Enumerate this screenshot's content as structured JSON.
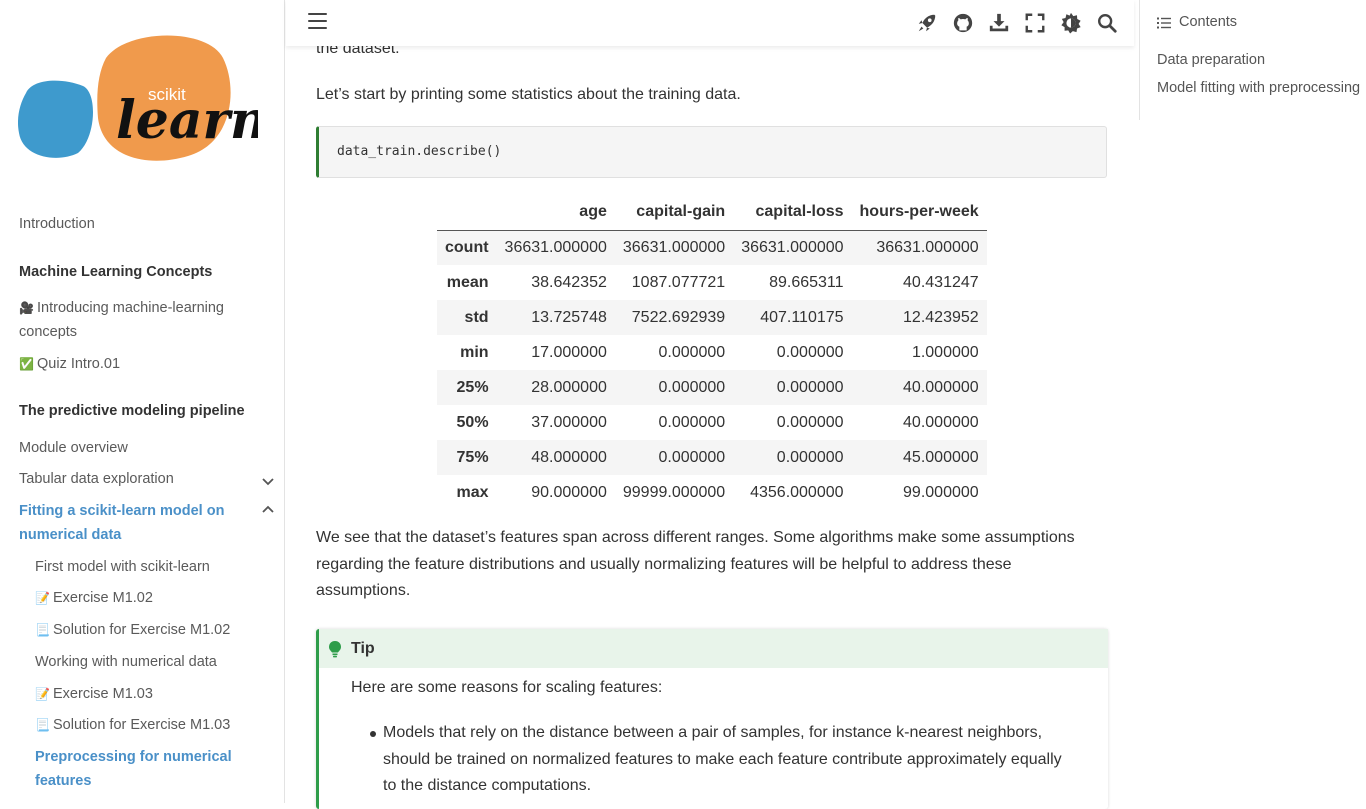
{
  "logo": {
    "text_small": "scikit",
    "text_large": "learn",
    "colors": {
      "orange": "#F09A4C",
      "blue": "#3E9ACD"
    }
  },
  "sidebar": {
    "items": [
      {
        "label": "Introduction",
        "style": "normal"
      },
      {
        "label": "Machine Learning Concepts",
        "style": "bold"
      },
      {
        "label": "Introducing machine-learning",
        "label2": "concepts",
        "icon": "🎥"
      },
      {
        "label": "Quiz Intro.01",
        "icon": "✅"
      },
      {
        "label": "The predictive modeling pipeline",
        "style": "bold"
      },
      {
        "label": "Module overview"
      },
      {
        "label": "Tabular data exploration",
        "chevron": "down"
      },
      {
        "label": "Fitting a scikit-learn model on",
        "label2": "numerical data",
        "style": "active",
        "chevron": "up"
      },
      {
        "label": "First model with scikit-learn"
      },
      {
        "label": "Exercise M1.02",
        "icon": "📝"
      },
      {
        "label": "Solution for Exercise M1.02",
        "icon": "📃"
      },
      {
        "label": "Working with numerical data"
      },
      {
        "label": "Exercise M1.03",
        "icon": "📝"
      },
      {
        "label": "Solution for Exercise M1.03",
        "icon": "📃"
      },
      {
        "label": "Preprocessing for numerical",
        "label2": "features",
        "style": "active"
      }
    ]
  },
  "toolbar": {
    "icons": [
      "menu-icon",
      "rocket-icon",
      "github-icon",
      "download-icon",
      "fullscreen-icon",
      "theme-icon",
      "search-icon"
    ]
  },
  "content": {
    "fragment": "the dataset.",
    "intro": "Let’s start by printing some statistics about the training data.",
    "code": "data_train.describe()",
    "table": {
      "columns": [
        "",
        "age",
        "capital-gain",
        "capital-loss",
        "hours-per-week"
      ],
      "rows": [
        [
          "count",
          "36631.000000",
          "36631.000000",
          "36631.000000",
          "36631.000000"
        ],
        [
          "mean",
          "38.642352",
          "1087.077721",
          "89.665311",
          "40.431247"
        ],
        [
          "std",
          "13.725748",
          "7522.692939",
          "407.110175",
          "12.423952"
        ],
        [
          "min",
          "17.000000",
          "0.000000",
          "0.000000",
          "1.000000"
        ],
        [
          "25%",
          "28.000000",
          "0.000000",
          "0.000000",
          "40.000000"
        ],
        [
          "50%",
          "37.000000",
          "0.000000",
          "0.000000",
          "40.000000"
        ],
        [
          "75%",
          "48.000000",
          "0.000000",
          "0.000000",
          "45.000000"
        ],
        [
          "max",
          "90.000000",
          "99999.000000",
          "4356.000000",
          "99.000000"
        ]
      ]
    },
    "para_line1": "We see that the dataset’s features span across different ranges. Some algorithms make some assumptions",
    "para_line2": "regarding the feature distributions and usually normalizing features will be helpful to address these",
    "para_line3": "assumptions.",
    "tip": {
      "title": "Tip",
      "intro": "Here are some reasons for scaling features:",
      "bullet_line1": "Models that rely on the distance between a pair of samples, for instance k-nearest neighbors,",
      "bullet_line2": "should be trained on normalized features to make each feature contribute approximately equally",
      "bullet_line3": "to the distance computations."
    }
  },
  "toc": {
    "title": "Contents",
    "items": [
      "Data preparation",
      "Model fitting with preprocessing"
    ]
  }
}
